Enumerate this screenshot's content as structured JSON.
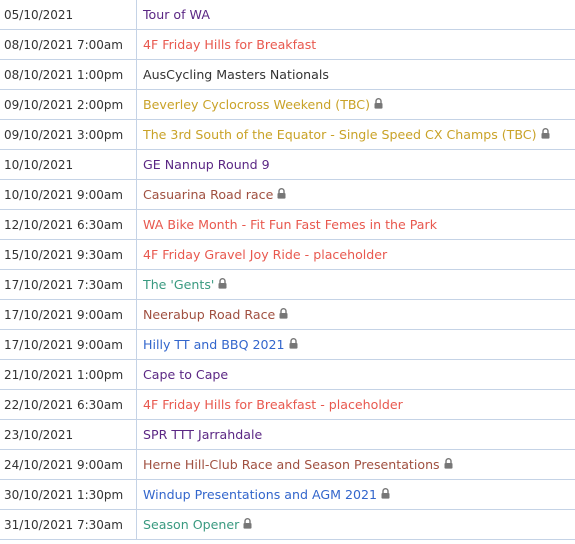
{
  "colors": {
    "purple": "#5b2784",
    "coral": "#e8584e",
    "dark": "#333333",
    "gold": "#c9a227",
    "brown": "#a05040",
    "teal": "#3a9a80",
    "blue": "#3366cc",
    "grid": "#c5d3e6",
    "lock": "#777777"
  },
  "events": [
    {
      "date": "05/10/2021",
      "title": "Tour of WA",
      "color": "#5b2784",
      "locked": false
    },
    {
      "date": "08/10/2021 7:00am",
      "title": "4F Friday Hills for Breakfast",
      "color": "#e8584e",
      "locked": false
    },
    {
      "date": "08/10/2021 1:00pm",
      "title": "AusCycling Masters Nationals",
      "color": "#333333",
      "locked": false
    },
    {
      "date": "09/10/2021 2:00pm",
      "title": "Beverley Cyclocross Weekend (TBC)",
      "color": "#c9a227",
      "locked": true
    },
    {
      "date": "09/10/2021 3:00pm",
      "title": "The 3rd South of the Equator - Single Speed CX Champs (TBC)",
      "color": "#c9a227",
      "locked": true
    },
    {
      "date": "10/10/2021",
      "title": "GE Nannup Round 9",
      "color": "#5b2784",
      "locked": false
    },
    {
      "date": "10/10/2021 9:00am",
      "title": "Casuarina Road race",
      "color": "#a05040",
      "locked": true
    },
    {
      "date": "12/10/2021 6:30am",
      "title": "WA Bike Month - Fit Fun Fast Femes in the Park",
      "color": "#e8584e",
      "locked": false
    },
    {
      "date": "15/10/2021 9:30am",
      "title": "4F Friday Gravel Joy Ride - placeholder",
      "color": "#e8584e",
      "locked": false
    },
    {
      "date": "17/10/2021 7:30am",
      "title": "The 'Gents'",
      "color": "#3a9a80",
      "locked": true
    },
    {
      "date": "17/10/2021 9:00am",
      "title": "Neerabup Road Race",
      "color": "#a05040",
      "locked": true
    },
    {
      "date": "17/10/2021 9:00am",
      "title": "Hilly TT and BBQ 2021",
      "color": "#3366cc",
      "locked": true
    },
    {
      "date": "21/10/2021 1:00pm",
      "title": "Cape to Cape",
      "color": "#5b2784",
      "locked": false
    },
    {
      "date": "22/10/2021 6:30am",
      "title": "4F Friday Hills for Breakfast - placeholder",
      "color": "#e8584e",
      "locked": false
    },
    {
      "date": "23/10/2021",
      "title": "SPR TTT Jarrahdale",
      "color": "#5b2784",
      "locked": false
    },
    {
      "date": "24/10/2021 9:00am",
      "title": "Herne Hill-Club Race and Season Presentations",
      "color": "#a05040",
      "locked": true
    },
    {
      "date": "30/10/2021 1:30pm",
      "title": "Windup Presentations and AGM 2021",
      "color": "#3366cc",
      "locked": true
    },
    {
      "date": "31/10/2021 7:30am",
      "title": "Season Opener",
      "color": "#3a9a80",
      "locked": true
    }
  ]
}
